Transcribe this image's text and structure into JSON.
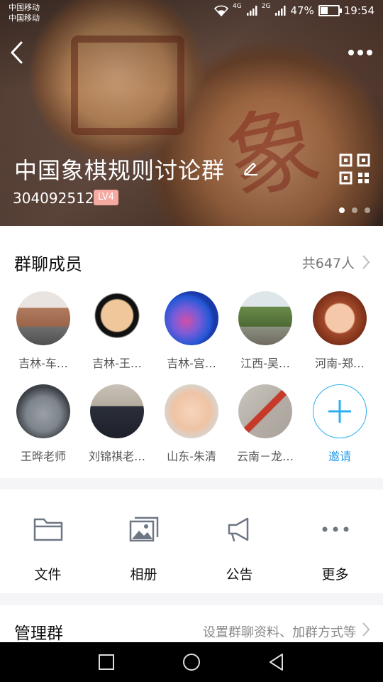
{
  "status": {
    "carrier1": "中国移动",
    "carrier2": "中国移动",
    "network1": "4G",
    "network2": "2G",
    "battery_percent": "47%",
    "battery_level": 0.47,
    "time": "19:54"
  },
  "header": {
    "group_name": "中国象棋规则讨论群",
    "group_id": "304092512",
    "level": "LV4",
    "page_count": 3,
    "active_page": 1
  },
  "members": {
    "title": "群聊成员",
    "count": "共647人",
    "list": [
      {
        "name": "吉林-车…"
      },
      {
        "name": "吉林-王…"
      },
      {
        "name": "吉林-宫…"
      },
      {
        "name": "江西-吴…"
      },
      {
        "name": "河南-郑…"
      },
      {
        "name": "王晔老师"
      },
      {
        "name": "刘锦祺老…"
      },
      {
        "name": "山东-朱清"
      },
      {
        "name": "云南－龙…"
      }
    ],
    "invite_label": "邀请"
  },
  "features": [
    {
      "label": "文件",
      "icon": "folder-icon"
    },
    {
      "label": "相册",
      "icon": "album-icon"
    },
    {
      "label": "公告",
      "icon": "megaphone-icon"
    },
    {
      "label": "更多",
      "icon": "more-icon"
    }
  ],
  "manage": {
    "title": "管理群",
    "desc": "设置群聊资料、加群方式等"
  },
  "colors": {
    "accent": "#2bafef",
    "level_badge": "#f5a9a0"
  }
}
